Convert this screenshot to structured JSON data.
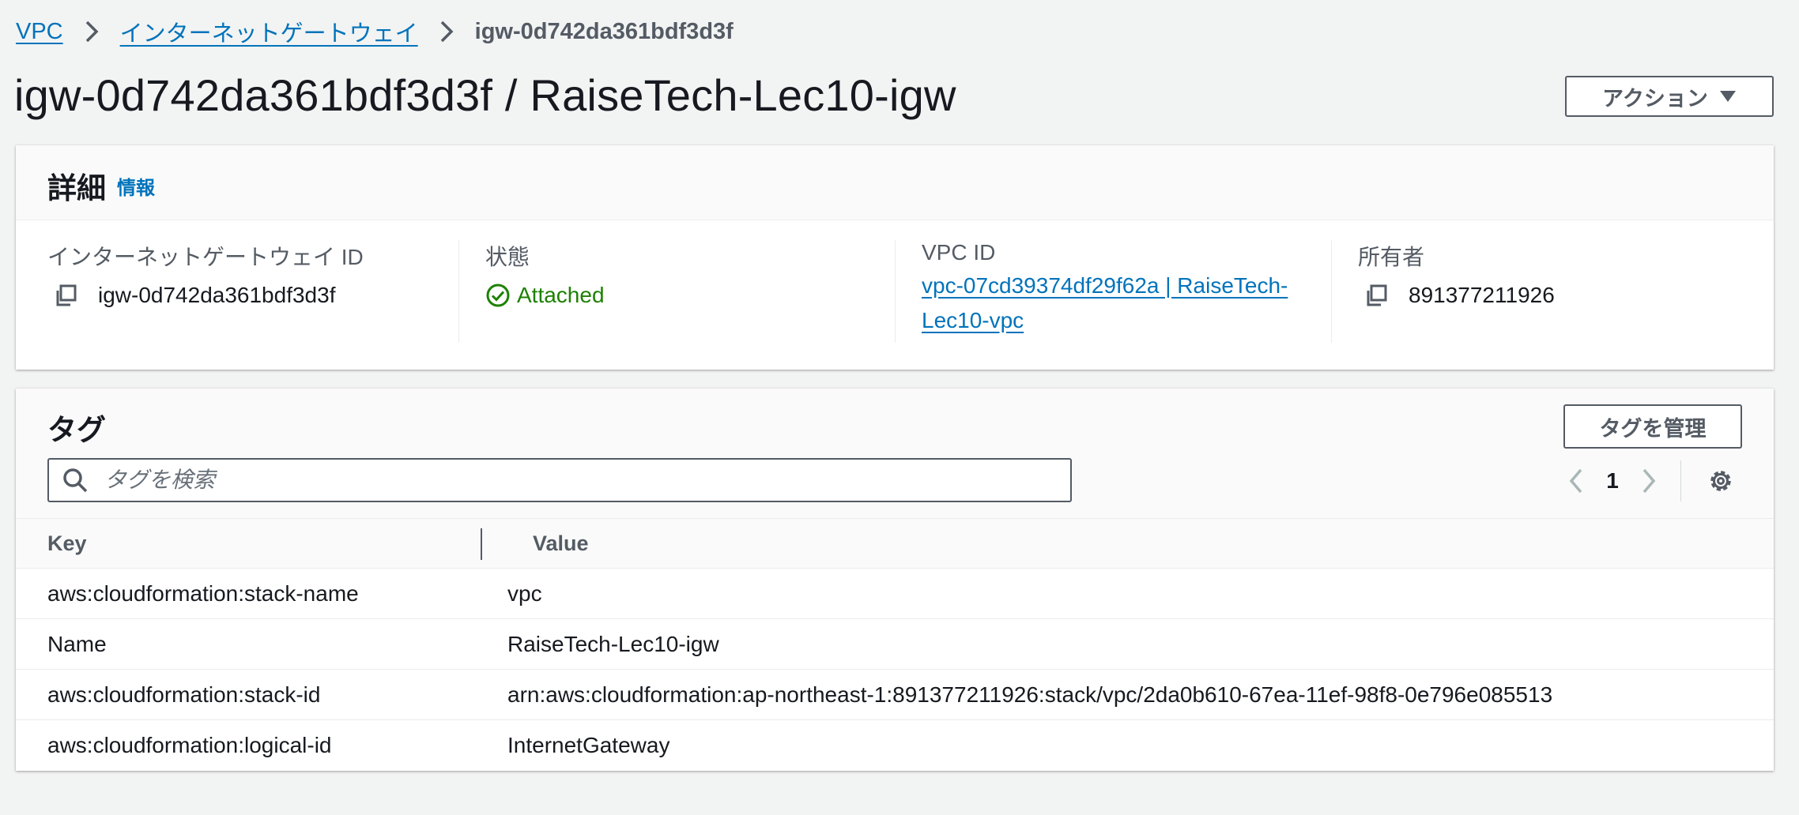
{
  "breadcrumb": {
    "items": [
      "VPC",
      "インターネットゲートウェイ"
    ],
    "current": "igw-0d742da361bdf3d3f"
  },
  "page": {
    "title": "igw-0d742da361bdf3d3f / RaiseTech-Lec10-igw",
    "action_label": "アクション"
  },
  "details": {
    "title": "詳細",
    "info_label": "情報",
    "fields": {
      "igw_id": {
        "label": "インターネットゲートウェイ ID",
        "value": "igw-0d742da361bdf3d3f"
      },
      "state": {
        "label": "状態",
        "value": "Attached"
      },
      "vpc_id": {
        "label": "VPC ID",
        "value": "vpc-07cd39374df29f62a | RaiseTech-Lec10-vpc"
      },
      "owner": {
        "label": "所有者",
        "value": "891377211926"
      }
    }
  },
  "tags": {
    "title": "タグ",
    "manage_label": "タグを管理",
    "search_placeholder": "タグを検索",
    "page_number": "1",
    "columns": [
      "Key",
      "Value"
    ],
    "rows": [
      {
        "key": "aws:cloudformation:stack-name",
        "value": "vpc"
      },
      {
        "key": "Name",
        "value": "RaiseTech-Lec10-igw"
      },
      {
        "key": "aws:cloudformation:stack-id",
        "value": "arn:aws:cloudformation:ap-northeast-1:891377211926:stack/vpc/2da0b610-67ea-11ef-98f8-0e796e085513"
      },
      {
        "key": "aws:cloudformation:logical-id",
        "value": "InternetGateway"
      }
    ]
  },
  "colors": {
    "link": "#0073bb",
    "success": "#1d8102",
    "text": "#16191f",
    "muted": "#545b64",
    "background": "#f2f3f3"
  },
  "icons": [
    "chevron-right-icon",
    "caret-down-icon",
    "copy-icon",
    "check-circle-icon",
    "search-icon",
    "chevron-left-icon",
    "gear-icon"
  ]
}
